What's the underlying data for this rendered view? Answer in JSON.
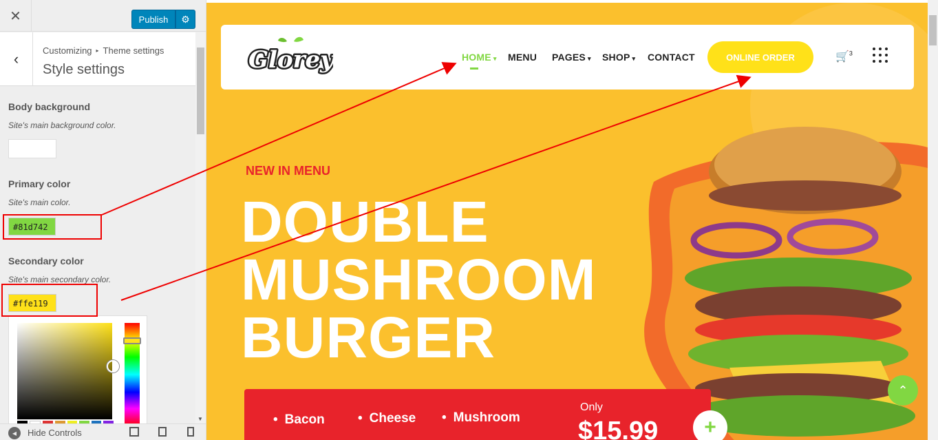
{
  "sidebar": {
    "publish_label": "Publish",
    "breadcrumb_root": "Customizing",
    "breadcrumb_sep": "▸",
    "breadcrumb_parent": "Theme settings",
    "section_title": "Style settings",
    "body_bg": {
      "label": "Body background",
      "desc": "Site's main background color."
    },
    "primary": {
      "label": "Primary color",
      "desc": "Site's main color.",
      "value": "#81d742"
    },
    "secondary": {
      "label": "Secondary color",
      "desc": "Site's main secondary color.",
      "value": "#ffe119"
    },
    "hide_controls": "Hide Controls"
  },
  "site": {
    "nav": [
      {
        "label": "HOME",
        "active": true,
        "dropdown": true
      },
      {
        "label": "MENU",
        "active": false,
        "dropdown": false
      },
      {
        "label": "PAGES",
        "active": false,
        "dropdown": true
      },
      {
        "label": "SHOP",
        "active": false,
        "dropdown": true
      },
      {
        "label": "CONTACT",
        "active": false,
        "dropdown": false
      }
    ],
    "order_button": "ONLINE ORDER",
    "cart_count": "3",
    "hero": {
      "eyebrow": "NEW IN MENU",
      "title_line1": "DOUBLE",
      "title_line2": "MUSHROOM",
      "title_line3": "BURGER",
      "ingredients": [
        "Bacon",
        "Cheese",
        "Mushroom"
      ],
      "only_label": "Only",
      "price": "$15.99"
    }
  },
  "colors": {
    "primary": "#81d742",
    "secondary": "#ffe119",
    "hero_bg": "#fbc02d",
    "promo_red": "#e8232b",
    "wp_blue": "#0085ba"
  }
}
